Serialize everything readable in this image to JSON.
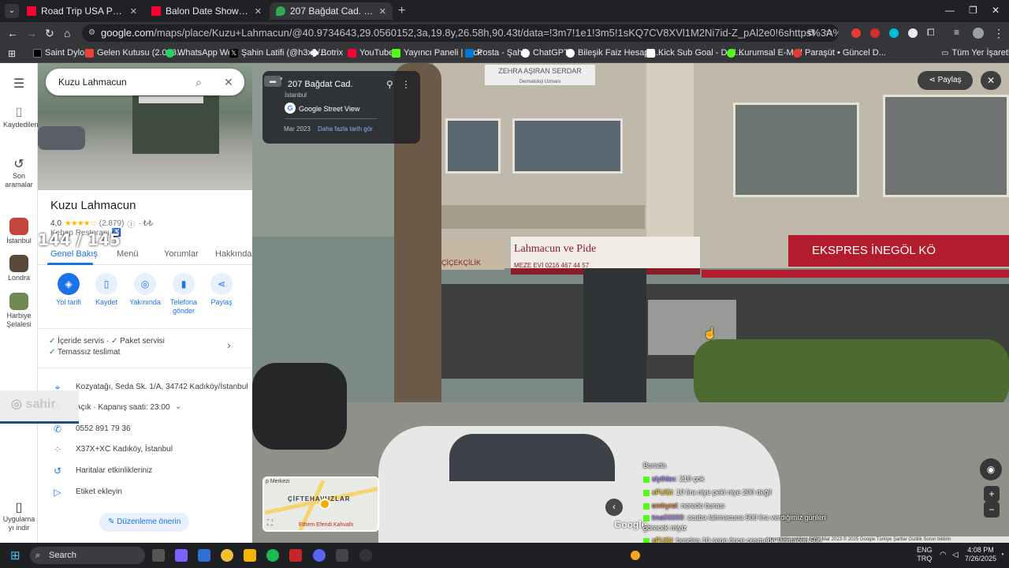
{
  "browser": {
    "tabs": [
      {
        "title": "Road Trip USA Part 13 - Driving",
        "active": false,
        "favicon_color": "#ff0033"
      },
      {
        "title": "Balon Date Show 15. Bölüm - Y",
        "active": false,
        "favicon_color": "#ff0033"
      },
      {
        "title": "207 Bağdat Cad. - Google Harit",
        "active": true,
        "favicon_color": "#34a853"
      }
    ],
    "url_host": "google.com",
    "url_path": "/maps/place/Kuzu+Lahmacun/@40.9734643,29.0560152,3a,19.8y,26.58h,90.43t/data=!3m7!1e1!3m5!1sKQ7CV8XVl1M2Ni7id-Z_pAl2e0!6shttps%3A%2F%2Fstreetviewpixels-pa.googleapis.com%2Fv1%2Fthu...",
    "bookmarks": [
      {
        "label": "Saint Dylon",
        "icon_color": "#000000"
      },
      {
        "label": "Gelen Kutusu (2.008...",
        "icon_color": "#ea4335"
      },
      {
        "label": "WhatsApp Web",
        "icon_color": "#25d366"
      },
      {
        "label": "Şahin Latifi (@h3x) /...",
        "icon_color": "#000000"
      },
      {
        "label": "Botrix",
        "icon_color": "#ffffff"
      },
      {
        "label": "YouTube",
        "icon_color": "#ff0033"
      },
      {
        "label": "Yayıncı Paneli | Kick",
        "icon_color": "#53fc18"
      },
      {
        "label": "Posta - Şahin",
        "icon_color": "#0078d4"
      },
      {
        "label": "ChatGPT",
        "icon_color": "#ffffff"
      },
      {
        "label": "Bileşik Faiz Hesapla...",
        "icon_color": "#ffffff"
      },
      {
        "label": "Kick Sub Goal - Dail...",
        "icon_color": "#ffffff"
      },
      {
        "label": "Kurumsal E-Mail",
        "icon_color": "#53fc18"
      },
      {
        "label": "Paraşüt • Güncel D...",
        "icon_color": "#e53935"
      }
    ],
    "all_bookmarks": "Tüm Yer İşaretleri"
  },
  "rail": {
    "saved": "Kaydedilenler",
    "recent": "Son aramalar",
    "places": [
      {
        "label": "İstanbul",
        "color": "#c2463e"
      },
      {
        "label": "Londra",
        "color": "#5a4a3a"
      },
      {
        "label": "Harbiye Şelalesi",
        "color": "#6f8a54"
      }
    ],
    "get_app": "Uygulama yı indir"
  },
  "panel": {
    "search_value": "Kuzu Lahmacun",
    "title": "Kuzu Lahmacun",
    "rating": "4,0",
    "stars": "★★★★☆",
    "review_count": "(2.879)",
    "price": "· ₺₺",
    "category": "Kebap Restoranı",
    "tabs": [
      "Genel Bakış",
      "Menü",
      "Yorumlar",
      "Hakkında"
    ],
    "actions": [
      {
        "label": "Yol tarifi",
        "glyph": "◈"
      },
      {
        "label": "Kaydet",
        "glyph": "▯"
      },
      {
        "label": "Yakınında",
        "glyph": "◎"
      },
      {
        "label": "Telefona gönder",
        "glyph": "▮"
      },
      {
        "label": "Paylaş",
        "glyph": "⋖"
      }
    ],
    "services_line1": "İçeride servis · ",
    "services_line1b": "Paket servisi",
    "services_line2": "Temassız teslimat",
    "address": "Kozyatağı, Seda Sk. 1/A, 34742 Kadıköy/İstanbul",
    "hours": "Açık · Kapanış saati: 23:00",
    "phone": "0552 891 79 36",
    "plus_code": "X37X+XC Kadıköy, İstanbul",
    "activity": "Haritalar etkinlikleriniz",
    "label": "Etiket ekleyin",
    "suggest_edit": "Düzenleme önerin"
  },
  "streetview": {
    "address": "207 Bağdat Cad.",
    "city": "İstanbul",
    "source": "Google Street View",
    "date": "Mar 2023",
    "more_dates": "Daha fazla tarih gör",
    "share": "Paylaş",
    "watermark": "Google",
    "footer": "Görüntünün çekilme tarihi: Mar 2023   © 2025 Google   Türkiye   Şartlar   Gizlilik   Sorun bildirin",
    "signs": {
      "lahmacun": "Lahmacun ve Pide",
      "meze": "MEZE EVİ  0216 467 44 57",
      "ekspres": "EKSPRES İNEGÖL KÖ",
      "cicekcilik": "ÇİÇEKÇİLİK",
      "doctor": "ZEHRA AŞIRAN SERDAR",
      "doctor_sub": "Dermatoloji Uzmanı"
    },
    "minimap": {
      "label1": "ÇİFTEHAVUZLAR",
      "label2": "Ethem Efendi Kahvaltı",
      "label3": "p Merkezi"
    }
  },
  "stream_overlay": {
    "counter": "144 / 145",
    "social": "sahir",
    "chat_top": "Burada",
    "chat": [
      {
        "user": "slythlex",
        "msg": ": 210 çok",
        "user_class": "u1"
      },
      {
        "user": "xFUGI",
        "msg": ": 10 lira niye peki niye 200 değil",
        "user_class": "u2"
      },
      {
        "user": "emhyrel",
        "msg": ": nerede burası",
        "user_class": "u3"
      },
      {
        "user": "tma00000",
        "msg": ": acaba lahmacuna 500 lira verdiğimiz günleri görecek miyiz",
        "user_class": "u1"
      },
      {
        "user": "xFUGI",
        "msg": ": bundan 10 sene önce çeşmede lahmacun 50tl haberleri vardı sen duşun",
        "user_class": "u2"
      }
    ]
  },
  "taskbar": {
    "search": "Search",
    "lang": "ENG",
    "lang2": "TRQ",
    "time": "4:08 PM",
    "date": "7/26/2025"
  }
}
